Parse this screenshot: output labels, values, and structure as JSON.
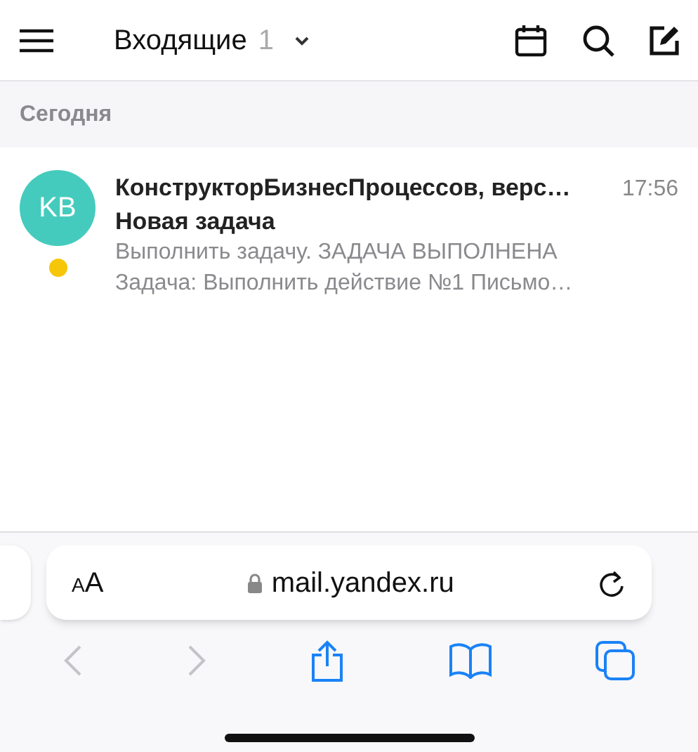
{
  "header": {
    "folder": "Входящие",
    "count": "1"
  },
  "section": "Сегодня",
  "messages": [
    {
      "initials": "KB",
      "color": "#45cbbd",
      "sender": "КонструкторБизнесПроцессов, верс…",
      "time": "17:56",
      "subject": "Новая задача",
      "snippet": [
        "Выполнить задачу. ЗАДАЧА ВЫПОЛНЕНА",
        "Задача: Выполнить действие №1 Письмо…"
      ],
      "unread": true
    }
  ],
  "browser": {
    "text_size": "AA",
    "url": "mail.yandex.ru"
  }
}
